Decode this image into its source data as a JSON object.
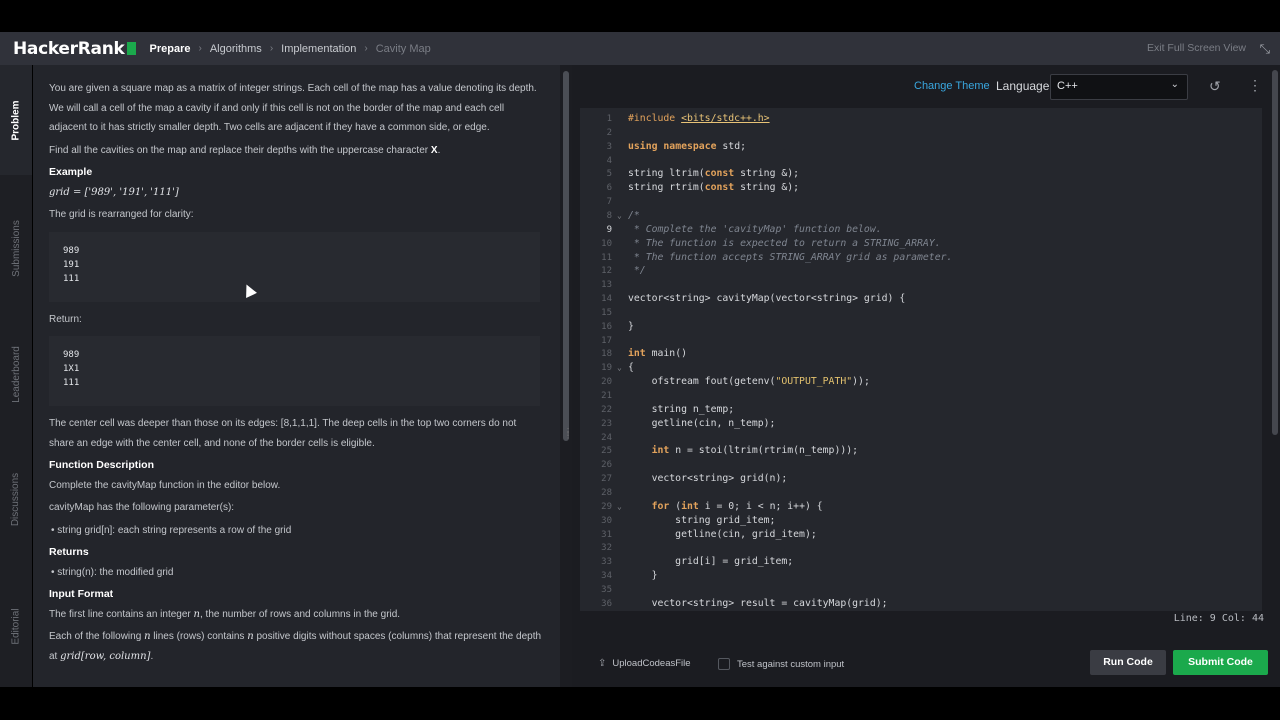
{
  "header": {
    "logo_text": "HackerRank",
    "breadcrumbs": [
      "Prepare",
      "Algorithms",
      "Implementation",
      "Cavity Map"
    ],
    "exit_fullscreen": "Exit Full Screen View"
  },
  "side_tabs": [
    "Problem",
    "Submissions",
    "Leaderboard",
    "Discussions",
    "Editorial"
  ],
  "problem": {
    "intro": "You are given a square map as a matrix of integer strings. Each cell of the map has a value denoting its depth. We will call a cell of the map a cavity if and only if this cell is not on the border of the map and each cell adjacent to it has strictly smaller depth. Two cells are adjacent if they have a common side, or edge.",
    "find_text": "Find all the cavities on the map and replace their depths with the uppercase character ",
    "find_char": "X",
    "find_end": ".",
    "example_heading": "Example",
    "example_grid": "grid = ['989', '191', '111']",
    "rearranged": "The grid is rearranged for clarity:",
    "grid_lines": [
      "989",
      "191",
      "111"
    ],
    "return_label": "Return:",
    "return_lines": [
      "989",
      "1X1",
      "111"
    ],
    "center_text": "The center cell was deeper than those on its edges: [8,1,1,1]. The deep cells in the top two corners do not share an edge with the center cell, and none of the border cells is eligible.",
    "function_heading": "Function Description",
    "function_text": "Complete the cavityMap function in the editor below.",
    "params_text": "cavityMap has the following parameter(s):",
    "param_item": "string grid[n]: each string represents a row of the grid",
    "returns_heading": "Returns",
    "returns_item": "string(n): the modified grid",
    "input_heading": "Input Format",
    "input_line1_a": "The first line contains an integer ",
    "input_line1_var": "n",
    "input_line1_b": ", the number of rows and columns in the grid.",
    "input_line2_a": "Each of the following ",
    "input_line2_var1": "n",
    "input_line2_b": " lines (rows) contains ",
    "input_line2_var2": "n",
    "input_line2_c": " positive digits without spaces (columns) that represent the depth at ",
    "input_line2_math": "grid[row, column]",
    "input_line2_end": "."
  },
  "editor": {
    "change_theme": "Change Theme",
    "language_label": "Language",
    "language_value": "C++",
    "active_line": 9,
    "status": "Line: 9 Col: 44",
    "lines": [
      {
        "n": 1,
        "t": "#include <bits/stdc++.h>"
      },
      {
        "n": 2,
        "t": ""
      },
      {
        "n": 3,
        "t": "using namespace std;"
      },
      {
        "n": 4,
        "t": ""
      },
      {
        "n": 5,
        "t": "string ltrim(const string &);"
      },
      {
        "n": 6,
        "t": "string rtrim(const string &);"
      },
      {
        "n": 7,
        "t": ""
      },
      {
        "n": 8,
        "t": "/*"
      },
      {
        "n": 9,
        "t": " * Complete the 'cavityMap' function below."
      },
      {
        "n": 10,
        "t": " * The function is expected to return a STRING_ARRAY."
      },
      {
        "n": 11,
        "t": " * The function accepts STRING_ARRAY grid as parameter."
      },
      {
        "n": 12,
        "t": " */"
      },
      {
        "n": 13,
        "t": ""
      },
      {
        "n": 14,
        "t": "vector<string> cavityMap(vector<string> grid) {"
      },
      {
        "n": 15,
        "t": ""
      },
      {
        "n": 16,
        "t": "}"
      },
      {
        "n": 17,
        "t": ""
      },
      {
        "n": 18,
        "t": "int main()"
      },
      {
        "n": 19,
        "t": "{"
      },
      {
        "n": 20,
        "t": "    ofstream fout(getenv(\"OUTPUT_PATH\"));"
      },
      {
        "n": 21,
        "t": ""
      },
      {
        "n": 22,
        "t": "    string n_temp;"
      },
      {
        "n": 23,
        "t": "    getline(cin, n_temp);"
      },
      {
        "n": 24,
        "t": ""
      },
      {
        "n": 25,
        "t": "    int n = stoi(ltrim(rtrim(n_temp)));"
      },
      {
        "n": 26,
        "t": ""
      },
      {
        "n": 27,
        "t": "    vector<string> grid(n);"
      },
      {
        "n": 28,
        "t": ""
      },
      {
        "n": 29,
        "t": "    for (int i = 0; i < n; i++) {"
      },
      {
        "n": 30,
        "t": "        string grid_item;"
      },
      {
        "n": 31,
        "t": "        getline(cin, grid_item);"
      },
      {
        "n": 32,
        "t": ""
      },
      {
        "n": 33,
        "t": "        grid[i] = grid_item;"
      },
      {
        "n": 34,
        "t": "    }"
      },
      {
        "n": 35,
        "t": ""
      },
      {
        "n": 36,
        "t": "    vector<string> result = cavityMap(grid);"
      }
    ]
  },
  "bottom": {
    "upload": "UploadCodeasFile",
    "custom_input": "Test against custom input",
    "run": "Run Code",
    "submit": "Submit Code"
  },
  "colors": {
    "accent_green": "#1ba94c",
    "link_blue": "#39a7e0",
    "keyword": "#e3a35c"
  }
}
